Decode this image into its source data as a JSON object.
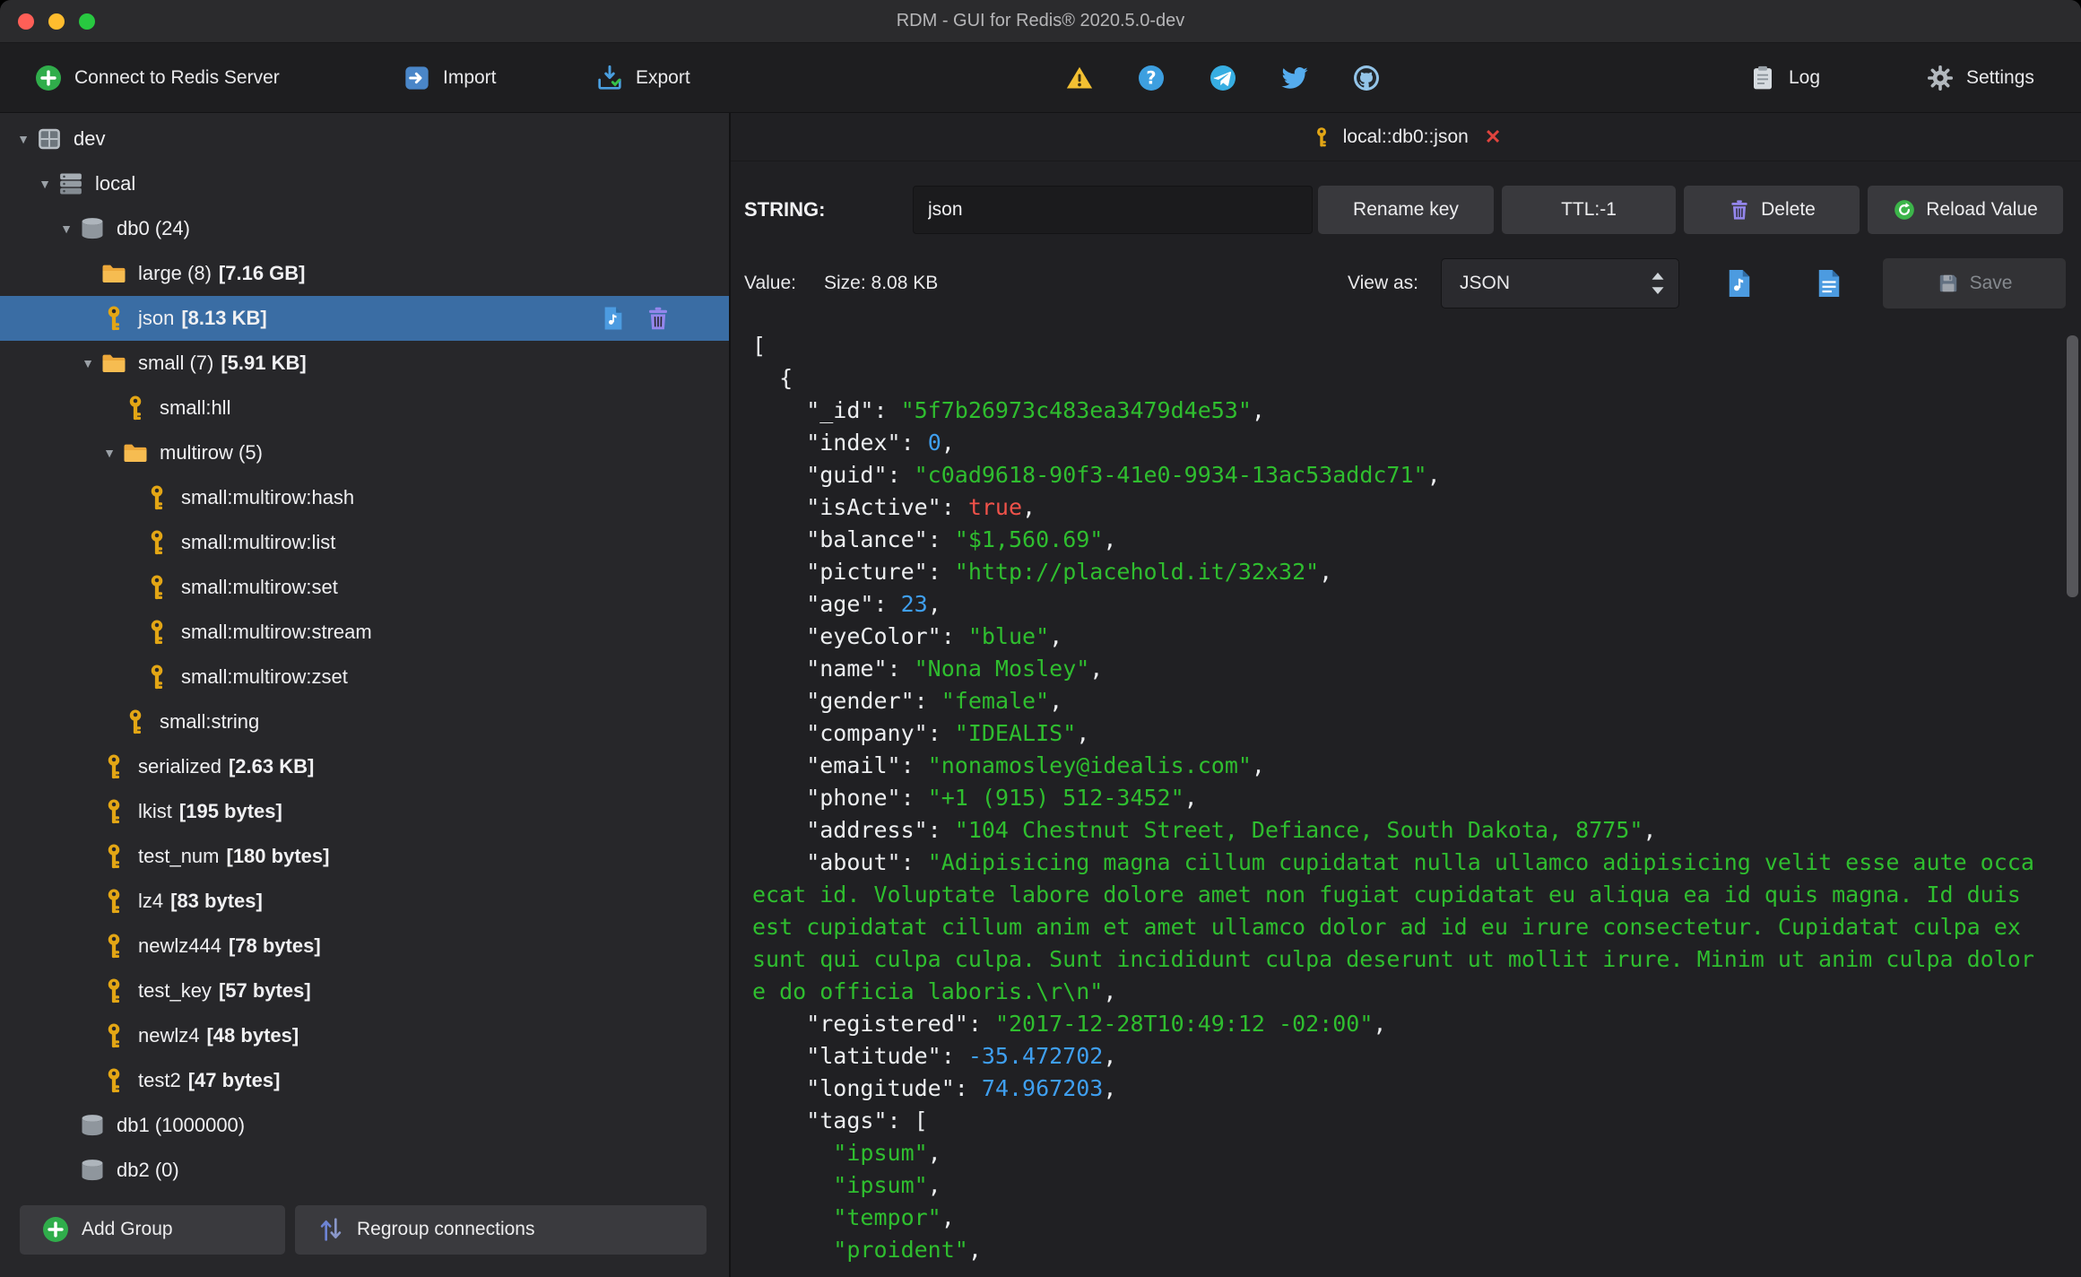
{
  "window": {
    "title": "RDM - GUI for Redis® 2020.5.0-dev"
  },
  "toolbar": {
    "connect_label": "Connect to Redis Server",
    "import_label": "Import",
    "export_label": "Export",
    "log_label": "Log",
    "settings_label": "Settings"
  },
  "sidebar": {
    "tree": [
      {
        "type": "server",
        "label": "dev",
        "level": 0,
        "arrow": "down"
      },
      {
        "type": "stack",
        "label": "local",
        "level": 1,
        "arrow": "down"
      },
      {
        "type": "db",
        "label": "db0  (24)",
        "level": 2,
        "arrow": "down"
      },
      {
        "type": "folder",
        "label": "large (8)",
        "bold": "[7.16 GB]",
        "level": 3,
        "arrow": "none"
      },
      {
        "type": "key",
        "label": "json",
        "bold": "[8.13 KB]",
        "level": 3,
        "arrow": "none",
        "selected": true,
        "actions": true
      },
      {
        "type": "folder",
        "label": "small (7)",
        "bold": "[5.91 KB]",
        "level": 3,
        "arrow": "down"
      },
      {
        "type": "key",
        "label": "small:hll",
        "level": 4,
        "arrow": "none"
      },
      {
        "type": "folder",
        "label": "multirow (5)",
        "level": 4,
        "arrow": "down"
      },
      {
        "type": "key",
        "label": "small:multirow:hash",
        "level": 5,
        "arrow": "none"
      },
      {
        "type": "key",
        "label": "small:multirow:list",
        "level": 5,
        "arrow": "none"
      },
      {
        "type": "key",
        "label": "small:multirow:set",
        "level": 5,
        "arrow": "none"
      },
      {
        "type": "key",
        "label": "small:multirow:stream",
        "level": 5,
        "arrow": "none"
      },
      {
        "type": "key",
        "label": "small:multirow:zset",
        "level": 5,
        "arrow": "none"
      },
      {
        "type": "key",
        "label": "small:string",
        "level": 4,
        "arrow": "none"
      },
      {
        "type": "key",
        "label": "serialized",
        "bold": "[2.63 KB]",
        "level": 3,
        "arrow": "none"
      },
      {
        "type": "key",
        "label": "lkist",
        "bold": "[195 bytes]",
        "level": 3,
        "arrow": "none"
      },
      {
        "type": "key",
        "label": "test_num",
        "bold": "[180 bytes]",
        "level": 3,
        "arrow": "none"
      },
      {
        "type": "key",
        "label": "lz4",
        "bold": "[83 bytes]",
        "level": 3,
        "arrow": "none"
      },
      {
        "type": "key",
        "label": "newlz444",
        "bold": "[78 bytes]",
        "level": 3,
        "arrow": "none"
      },
      {
        "type": "key",
        "label": "test_key",
        "bold": "[57 bytes]",
        "level": 3,
        "arrow": "none"
      },
      {
        "type": "key",
        "label": "newlz4",
        "bold": "[48 bytes]",
        "level": 3,
        "arrow": "none"
      },
      {
        "type": "key",
        "label": "test2",
        "bold": "[47 bytes]",
        "level": 3,
        "arrow": "none"
      },
      {
        "type": "db",
        "label": "db1  (1000000)",
        "level": 2,
        "arrow": "none"
      },
      {
        "type": "db",
        "label": "db2  (0)",
        "level": 2,
        "arrow": "none"
      }
    ],
    "add_group_label": "Add Group",
    "regroup_label": "Regroup connections"
  },
  "main": {
    "tab_label": "local::db0::json",
    "editor": {
      "type_label": "STRING:",
      "key_value": "json",
      "rename_label": "Rename key",
      "ttl_label": "TTL:-1",
      "delete_label": "Delete",
      "reload_label": "Reload Value",
      "value_label": "Value:",
      "size_label": "Size: 8.08 KB",
      "view_as_label": "View as:",
      "view_mode": "JSON",
      "save_label": "Save"
    },
    "code_lines": [
      [
        [
          "p",
          "["
        ]
      ],
      [
        [
          "p",
          "  {"
        ]
      ],
      [
        [
          "k",
          "    \"_id\""
        ],
        [
          "p",
          ": "
        ],
        [
          "s",
          "\"5f7b26973c483ea3479d4e53\""
        ],
        [
          "p",
          ","
        ]
      ],
      [
        [
          "k",
          "    \"index\""
        ],
        [
          "p",
          ": "
        ],
        [
          "n",
          "0"
        ],
        [
          "p",
          ","
        ]
      ],
      [
        [
          "k",
          "    \"guid\""
        ],
        [
          "p",
          ": "
        ],
        [
          "s",
          "\"c0ad9618-90f3-41e0-9934-13ac53addc71\""
        ],
        [
          "p",
          ","
        ]
      ],
      [
        [
          "k",
          "    \"isActive\""
        ],
        [
          "p",
          ": "
        ],
        [
          "b",
          "true"
        ],
        [
          "p",
          ","
        ]
      ],
      [
        [
          "k",
          "    \"balance\""
        ],
        [
          "p",
          ": "
        ],
        [
          "s",
          "\"$1,560.69\""
        ],
        [
          "p",
          ","
        ]
      ],
      [
        [
          "k",
          "    \"picture\""
        ],
        [
          "p",
          ": "
        ],
        [
          "s",
          "\"http://placehold.it/32x32\""
        ],
        [
          "p",
          ","
        ]
      ],
      [
        [
          "k",
          "    \"age\""
        ],
        [
          "p",
          ": "
        ],
        [
          "n",
          "23"
        ],
        [
          "p",
          ","
        ]
      ],
      [
        [
          "k",
          "    \"eyeColor\""
        ],
        [
          "p",
          ": "
        ],
        [
          "s",
          "\"blue\""
        ],
        [
          "p",
          ","
        ]
      ],
      [
        [
          "k",
          "    \"name\""
        ],
        [
          "p",
          ": "
        ],
        [
          "s",
          "\"Nona Mosley\""
        ],
        [
          "p",
          ","
        ]
      ],
      [
        [
          "k",
          "    \"gender\""
        ],
        [
          "p",
          ": "
        ],
        [
          "s",
          "\"female\""
        ],
        [
          "p",
          ","
        ]
      ],
      [
        [
          "k",
          "    \"company\""
        ],
        [
          "p",
          ": "
        ],
        [
          "s",
          "\"IDEALIS\""
        ],
        [
          "p",
          ","
        ]
      ],
      [
        [
          "k",
          "    \"email\""
        ],
        [
          "p",
          ": "
        ],
        [
          "s",
          "\"nonamosley@idealis.com\""
        ],
        [
          "p",
          ","
        ]
      ],
      [
        [
          "k",
          "    \"phone\""
        ],
        [
          "p",
          ": "
        ],
        [
          "s",
          "\"+1 (915) 512-3452\""
        ],
        [
          "p",
          ","
        ]
      ],
      [
        [
          "k",
          "    \"address\""
        ],
        [
          "p",
          ": "
        ],
        [
          "s",
          "\"104 Chestnut Street, Defiance, South Dakota, 8775\""
        ],
        [
          "p",
          ","
        ]
      ],
      [
        [
          "k",
          "    \"about\""
        ],
        [
          "p",
          ": "
        ],
        [
          "s",
          "\"Adipisicing magna cillum cupidatat nulla ullamco adipisicing velit esse aute occa"
        ]
      ],
      [
        [
          "s",
          "ecat id. Voluptate labore dolore amet non fugiat cupidatat eu aliqua ea id quis magna. Id duis "
        ]
      ],
      [
        [
          "s",
          "est cupidatat cillum anim et amet ullamco dolor ad id eu irure consectetur. Cupidatat culpa ex "
        ]
      ],
      [
        [
          "s",
          "sunt qui culpa culpa. Sunt incididunt culpa deserunt ut mollit irure. Minim ut anim culpa dolor"
        ]
      ],
      [
        [
          "s",
          "e do officia laboris.\\r\\n\""
        ],
        [
          "p",
          ","
        ]
      ],
      [
        [
          "k",
          "    \"registered\""
        ],
        [
          "p",
          ": "
        ],
        [
          "s",
          "\"2017-12-28T10:49:12 -02:00\""
        ],
        [
          "p",
          ","
        ]
      ],
      [
        [
          "k",
          "    \"latitude\""
        ],
        [
          "p",
          ": "
        ],
        [
          "n",
          "-35.472702"
        ],
        [
          "p",
          ","
        ]
      ],
      [
        [
          "k",
          "    \"longitude\""
        ],
        [
          "p",
          ": "
        ],
        [
          "n",
          "74.967203"
        ],
        [
          "p",
          ","
        ]
      ],
      [
        [
          "k",
          "    \"tags\""
        ],
        [
          "p",
          ": ["
        ]
      ],
      [
        [
          "s",
          "      \"ipsum\""
        ],
        [
          "p",
          ","
        ]
      ],
      [
        [
          "s",
          "      \"ipsum\""
        ],
        [
          "p",
          ","
        ]
      ],
      [
        [
          "s",
          "      \"tempor\""
        ],
        [
          "p",
          ","
        ]
      ],
      [
        [
          "s",
          "      \"proident\""
        ],
        [
          "p",
          ","
        ]
      ]
    ]
  },
  "icons": {
    "expanded_arrow": "▼",
    "close_tab": "✕"
  },
  "colors": {
    "selection_blue": "#3a6da4",
    "string_green": "#2fbe2f",
    "number_blue": "#3f9ff0",
    "boolean_red": "#f0524a",
    "key_gold": "#E3A615",
    "folder_yellow": "#EDA83A",
    "trash_purple": "#9486ec",
    "reload_green": "#3cb54a"
  }
}
